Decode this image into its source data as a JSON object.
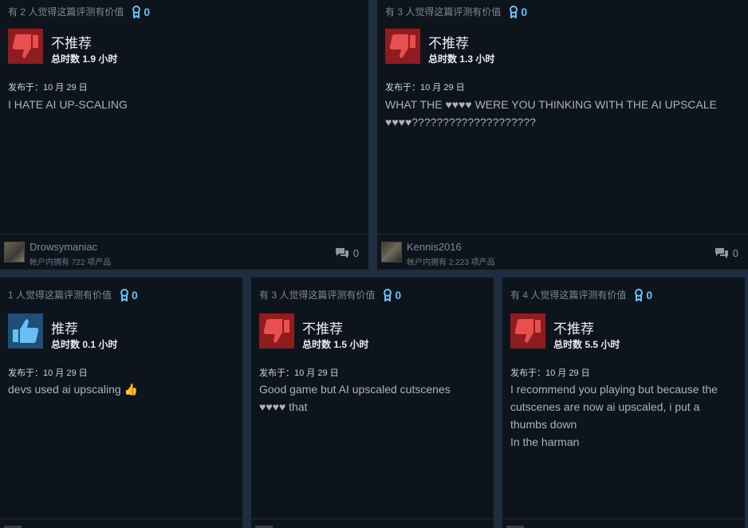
{
  "colors": {
    "page_bg": "#1e2d3f",
    "card_bg": "#0e141c",
    "thumbs_down_bg": "#8f1c1f",
    "thumbs_down_icon": "#e8504f",
    "thumbs_up_bg": "#1d4f79",
    "thumbs_up_icon": "#66c0f4",
    "award_blue": "#67c1f5"
  },
  "reviews": [
    {
      "helpful": "有 2 人觉得这篇评测有价值",
      "awards": "0",
      "recommended": false,
      "verdict": "不推荐",
      "hours": "总时数 1.9 小时",
      "posted": "发布于：10 月 29 日",
      "text": "I HATE AI UP-SCALING",
      "username": "Drowsymaniac",
      "owned": "帐户内拥有 722 项产品",
      "comments": "0",
      "icon": "thumbs-down-icon"
    },
    {
      "helpful": "有 3 人觉得这篇评测有价值",
      "awards": "0",
      "recommended": false,
      "verdict": "不推荐",
      "hours": "总时数 1.3 小时",
      "posted": "发布于：10 月 29 日",
      "text": "WHAT THE ♥♥♥♥ WERE YOU THINKING WITH THE AI UPSCALE ♥♥♥♥????????????????????",
      "username": "Kennis2016",
      "owned": "帐户内拥有 2,223 项产品",
      "comments": "0",
      "icon": "thumbs-down-icon"
    },
    {
      "helpful": "1 人觉得这篇评测有价值",
      "awards": "0",
      "recommended": true,
      "verdict": "推荐",
      "hours": "总时数 0.1 小时",
      "posted": "发布于：10 月 29 日",
      "text": "devs used ai upscaling 👍",
      "icon": "thumbs-up-icon"
    },
    {
      "helpful": "有 3 人觉得这篇评测有价值",
      "awards": "0",
      "recommended": false,
      "verdict": "不推荐",
      "hours": "总时数 1.5 小时",
      "posted": "发布于：10 月 29 日",
      "text": "Good game but AI upscaled cutscenes\n♥♥♥♥ that",
      "icon": "thumbs-down-icon"
    },
    {
      "helpful": "有 4 人觉得这篇评测有价值",
      "awards": "0",
      "recommended": false,
      "verdict": "不推荐",
      "hours": "总时数 5.5 小时",
      "posted": "发布于：10 月 29 日",
      "text": "I recommend you playing but because the cutscenes are now ai upscaled, i put a thumbs down\nIn the harman",
      "icon": "thumbs-down-icon"
    }
  ]
}
